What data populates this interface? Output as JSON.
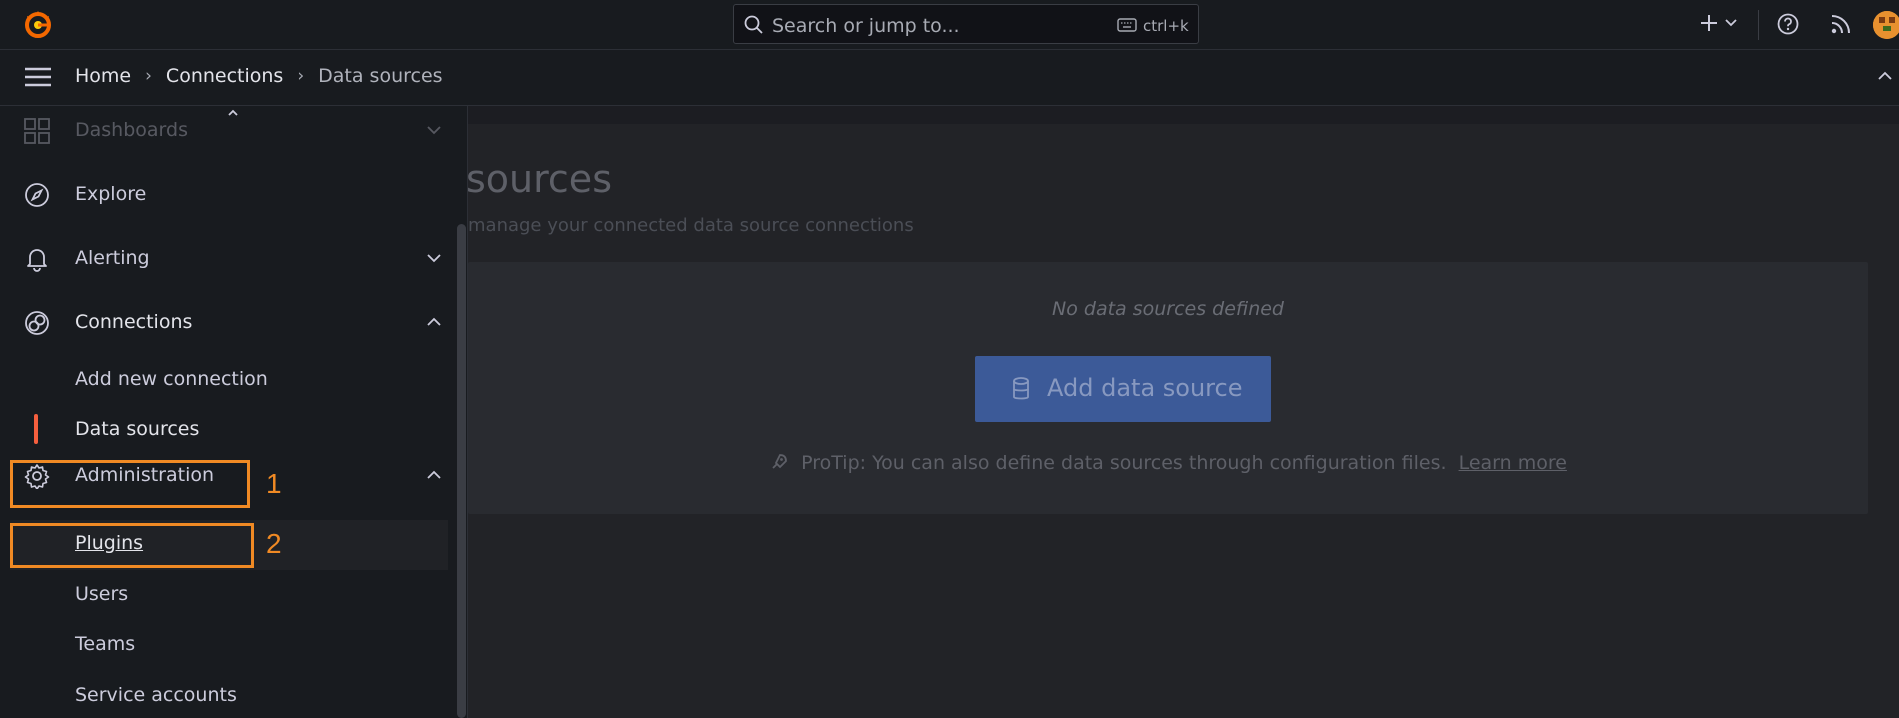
{
  "topbar": {
    "search_placeholder": "Search or jump to...",
    "search_shortcut": "ctrl+k"
  },
  "breadcrumb": {
    "items": [
      "Home",
      "Connections",
      "Data sources"
    ],
    "separator": "›"
  },
  "sidebar": {
    "items": [
      {
        "label": "Dashboards"
      },
      {
        "label": "Explore"
      },
      {
        "label": "Alerting"
      },
      {
        "label": "Connections"
      }
    ],
    "connections_children": [
      "Add new connection",
      "Data sources"
    ],
    "admin_label": "Administration",
    "admin_children": [
      "Plugins",
      "Users",
      "Teams",
      "Service accounts"
    ]
  },
  "main": {
    "title": "sources",
    "subtitle": "manage your connected data source connections",
    "empty_text": "No data sources defined",
    "add_button": "Add data source",
    "protip": "ProTip: You can also define data sources through configuration files.",
    "learn_more": "Learn more"
  },
  "annotations": [
    "1",
    "2"
  ],
  "colors": {
    "accent_orange": "#f08a24",
    "active_marker": "#f55f3e",
    "primary_button": "#3c5a98",
    "background": "#111217",
    "panel": "#181b1f"
  },
  "icons": {
    "logo": "grafana-logo",
    "search": "search-icon",
    "keyboard": "keyboard-icon",
    "plus": "plus-icon",
    "help": "help-icon",
    "news": "rss-icon",
    "menu": "hamburger-icon",
    "dashboards": "apps-icon",
    "explore": "compass-icon",
    "alerting": "bell-icon",
    "connections": "connections-icon",
    "administration": "gear-icon",
    "database": "database-icon",
    "rocket": "rocket-icon"
  }
}
